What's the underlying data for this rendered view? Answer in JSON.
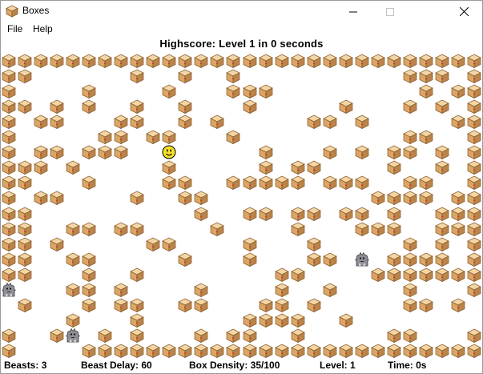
{
  "window": {
    "title": "Boxes"
  },
  "menu": {
    "file": "File",
    "help": "Help"
  },
  "highscore": "Highscore:  Level 1 in 0 seconds",
  "status": {
    "beasts": "Beasts: 3",
    "beast_delay": "Beast Delay: 60",
    "box_density": "Box Density: 35/100",
    "level": "Level: 1",
    "time": "Time: 0s"
  },
  "colors": {
    "box_top": "#f3d6a4",
    "box_left": "#d9a665",
    "box_right": "#b9854b",
    "box_outline": "#8a5a2b",
    "box_tape": "#d43a2e",
    "player": "#f5e12a",
    "beast": "#8e8e96"
  },
  "icons": {
    "app": "box-icon",
    "minimize": "minimize-icon",
    "maximize": "maximize-icon",
    "close": "close-icon"
  },
  "board": {
    "legend": {
      "B": "box",
      "P": "player",
      "M": "beast",
      ".": "empty"
    },
    "rows": [
      "BBBBBBBBBBBBBBBBBBBBBBBBBBBBBB",
      "BB......B..B..B..........BBB.B",
      "B....B....B...BBB.........B.BB",
      "BB.B.B..B..B...B.....B...B.B.B",
      "B.BB...BB..B.B.....BB.B.....BB",
      "B.....BB.BB...B..........BB..B",
      "B.BB.BBB..P.....B...B.B.BB.B.B",
      "BBB.B.....B.....B.BB....B..B.B",
      "BB...B....BB..BBBBB.BBB..BB..B",
      "B.BB....B..BB..........BBBB.BB",
      "BB..........B..BB.BB.BB.B..BBB",
      "BB..BB.BB....B....B...BBB..BBB",
      "BB.B.....BB....B...B.....B.B.B",
      "BB..BB.....B...B...BB.M.BBBB.B",
      "BB...B..B........BB....BBBBBBB",
      "M...BB.B....B....B..B....B...B",
      ".B...B.BB..BB...BB.B.....BB.B.",
      "....B...B......BBBB..B........",
      "B..BM.B.B...B.BB..B.....BB...B",
      "B....BBBBBBBBBBBBBBBBBBBBBBBBB"
    ]
  }
}
